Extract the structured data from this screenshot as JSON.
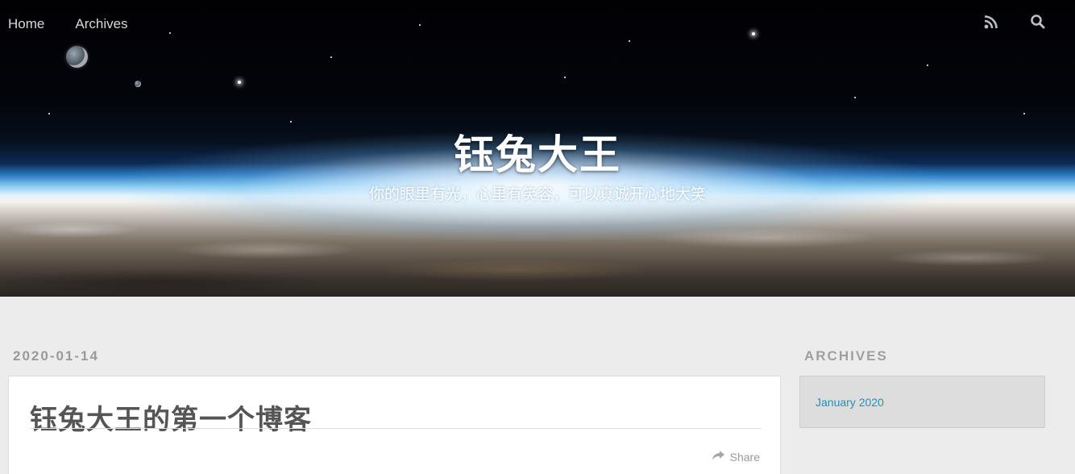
{
  "nav": {
    "items": [
      {
        "label": "Home"
      },
      {
        "label": "Archives"
      }
    ],
    "icons": [
      "rss-icon",
      "search-icon"
    ]
  },
  "site": {
    "title": "钰兔大王",
    "subtitle": "你的眼里有光，心里有笑容，可以真诚开心地大笑"
  },
  "post": {
    "date": "2020-01-14",
    "title": "钰兔大王的第一个博客",
    "share_label": "Share"
  },
  "sidebar": {
    "archives_title": "ARCHIVES",
    "archives": [
      {
        "label": "January 2020"
      }
    ]
  },
  "colors": {
    "page_background": "#ececec",
    "link": "#258fb8",
    "muted_text": "#9a9a9a"
  }
}
